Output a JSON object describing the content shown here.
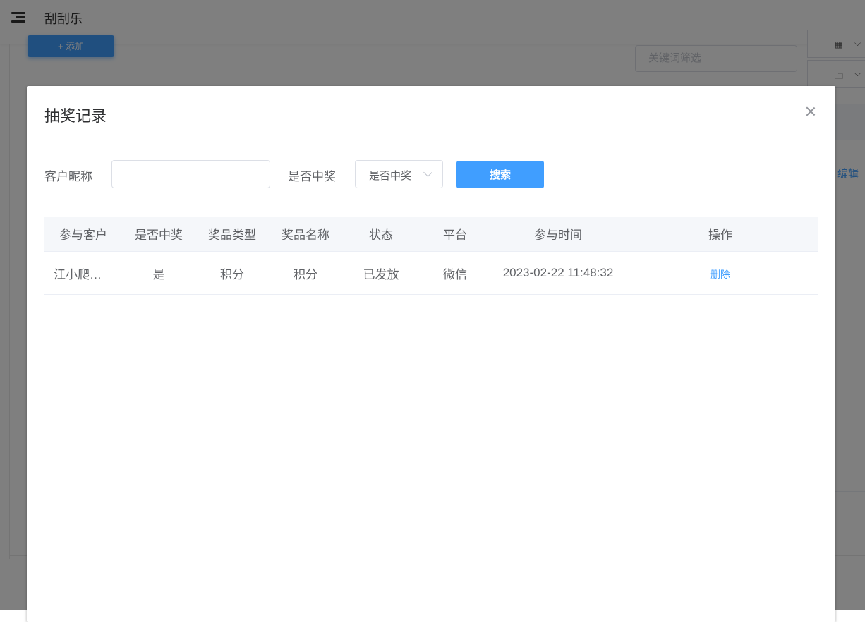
{
  "background": {
    "page_title": "刮刮乐",
    "add_button": "+ 添加",
    "keyword_placeholder": "关键词筛选",
    "edit_link": "编辑",
    "grid_icon": "▦",
    "folder_icon": "🗀",
    "chevron": "⌵"
  },
  "dialog": {
    "title": "抽奖记录",
    "filters": {
      "nickname_label": "客户昵称",
      "nickname_value": "",
      "win_label": "是否中奖",
      "win_select_value": "是否中奖",
      "search_button": "搜索"
    },
    "table": {
      "headers": [
        "参与客户",
        "是否中奖",
        "奖品类型",
        "奖品名称",
        "状态",
        "平台",
        "参与时间",
        "操作"
      ],
      "rows": [
        {
          "customer": "江小爬…",
          "won": "是",
          "prize_type": "积分",
          "prize_name": "积分",
          "status": "已发放",
          "platform": "微信",
          "time": "2023-02-22 11:48:32",
          "action": "删除"
        }
      ]
    }
  },
  "colors": {
    "primary": "#409eff",
    "overlay": "rgba(0,0,0,0.5)",
    "header_bg": "#f5f7fa",
    "text": "#606266"
  }
}
